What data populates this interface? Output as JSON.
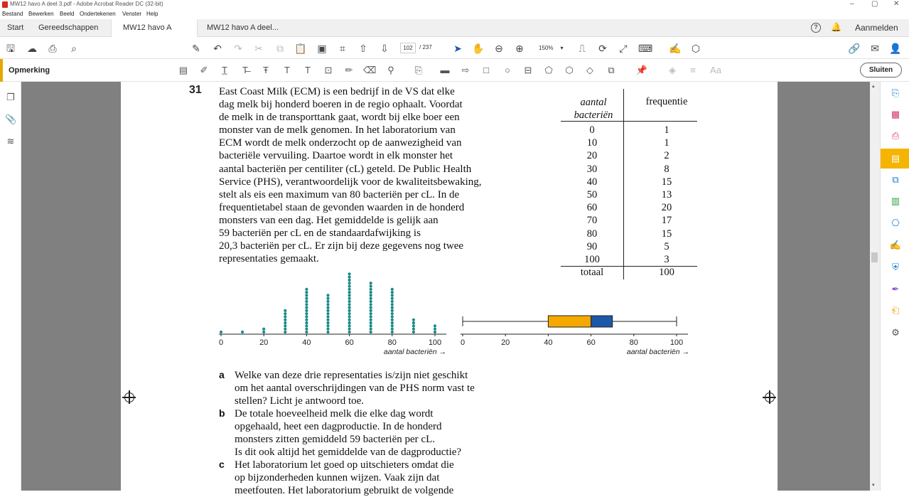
{
  "window": {
    "title": "MW12 havo A deel 3.pdf - Adobe Acrobat Reader DC (32-bit)",
    "minimize": "–",
    "maximize": "▢",
    "close": "✕"
  },
  "menu": [
    "Bestand",
    "Bewerken",
    "Beeld",
    "Ondertekenen",
    "Venster",
    "Help"
  ],
  "tabs": {
    "start": "Start",
    "tools": "Gereedschappen",
    "doc_active": "MW12 havo A deel...",
    "doc_active_close": "×",
    "doc_other": "MW12 havo A deel..."
  },
  "header": {
    "help": "?",
    "signin": "Aanmelden"
  },
  "toolbar": {
    "current_page": "102",
    "page_total": "/ 237",
    "zoom": "150%"
  },
  "comment_bar": {
    "label": "Opmerking",
    "close": "Sluiten",
    "text_tool": "Aa"
  },
  "document": {
    "question_number": "31",
    "intro_lines": [
      "East Coast Milk (ECM) is een bedrijf in de VS dat elke",
      "dag melk bij honderd boeren in de regio ophaalt. Voordat",
      "de melk in de transporttank gaat, wordt bij elke boer een",
      "monster van de melk genomen. In het laboratorium van",
      "ECM wordt de melk onderzocht op de aanwezigheid van",
      "bacteriële vervuiling. Daartoe wordt in elk monster het",
      "aantal bacteriën per centiliter (cL) geteld. De Public Health",
      "Service (PHS), verantwoordelijk voor de kwaliteitsbewaking,",
      "stelt als eis een maximum van 80 bacteriën per cL. In de",
      "frequentietabel staan de gevonden waarden in de honderd",
      "monsters van een dag. Het gemiddelde is gelijk aan",
      "59 bacteriën per cL en de standaardafwijking is",
      "20,3 bacteriën per cL. Er zijn bij deze gegevens nog twee",
      "representaties gemaakt."
    ],
    "table": {
      "header_left_line1": "aantal",
      "header_left_line2": "bacteriën",
      "header_right": "frequentie",
      "rows": [
        [
          "0",
          "1"
        ],
        [
          "10",
          "1"
        ],
        [
          "20",
          "2"
        ],
        [
          "30",
          "8"
        ],
        [
          "40",
          "15"
        ],
        [
          "50",
          "13"
        ],
        [
          "60",
          "20"
        ],
        [
          "70",
          "17"
        ],
        [
          "80",
          "15"
        ],
        [
          "90",
          "5"
        ],
        [
          "100",
          "3"
        ]
      ],
      "total_label": "totaal",
      "total_value": "100"
    },
    "questions": {
      "a_label": "a",
      "a_lines": [
        "Welke van deze drie representaties is/zijn niet geschikt",
        "om het aantal overschrijdingen van de PHS norm vast te",
        "stellen? Licht je antwoord toe."
      ],
      "b_label": "b",
      "b_lines": [
        "De totale hoeveelheid melk die elke dag wordt",
        "opgehaald, heet een dagproductie. In de honderd",
        "monsters zitten gemiddeld 59 bacteriën per cL.",
        "Is dit ook altijd het gemiddelde van de dagproductie?"
      ],
      "c_label": "c",
      "c_lines": [
        "Het laboratorium let goed op uitschieters omdat die",
        "op bijzonderheden kunnen wijzen. Vaak zijn dat",
        "meetfouten. Het laboratorium gebruikt de volgende"
      ]
    }
  },
  "chart_data": [
    {
      "type": "scatter",
      "subtype": "dot-plot",
      "x": [
        0,
        10,
        20,
        30,
        40,
        50,
        60,
        70,
        80,
        90,
        100
      ],
      "counts": [
        1,
        1,
        2,
        8,
        15,
        13,
        20,
        17,
        15,
        5,
        3
      ],
      "xlabel": "aantal bacteriën →",
      "xticks": [
        "0",
        "20",
        "40",
        "60",
        "80",
        "100"
      ],
      "xlim": [
        0,
        100
      ],
      "color": "#1a8a8a"
    },
    {
      "type": "boxplot",
      "min": 0,
      "q1": 40,
      "median": 60,
      "q3": 70,
      "max": 100,
      "xlabel": "aantal bacteriën →",
      "xticks": [
        "0",
        "20",
        "40",
        "60",
        "80",
        "100"
      ],
      "xlim": [
        0,
        100
      ],
      "colors": {
        "lower_box": "#f5a800",
        "upper_box": "#1d57a8"
      }
    }
  ]
}
